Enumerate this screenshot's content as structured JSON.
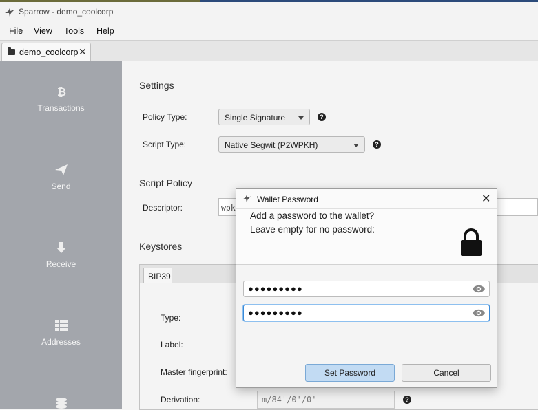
{
  "window": {
    "title": "Sparrow - demo_coolcorp"
  },
  "menu": [
    {
      "label": "File"
    },
    {
      "label": "View"
    },
    {
      "label": "Tools"
    },
    {
      "label": "Help"
    }
  ],
  "tab": {
    "label": "demo_coolcorp",
    "close": "✕"
  },
  "sidebar": {
    "items": [
      {
        "label": "Transactions",
        "icon": "bitcoin-icon"
      },
      {
        "label": "Send",
        "icon": "send-icon"
      },
      {
        "label": "Receive",
        "icon": "arrow-down-icon"
      },
      {
        "label": "Addresses",
        "icon": "list-icon"
      },
      {
        "label": "",
        "icon": "coins-icon"
      }
    ]
  },
  "settings": {
    "title": "Settings",
    "policy_type_label": "Policy Type:",
    "policy_type_value": "Single Signature",
    "script_type_label": "Script Type:",
    "script_type_value": "Native Segwit (P2WPKH)",
    "script_policy_title": "Script Policy",
    "descriptor_label": "Descriptor:",
    "descriptor_value": "wpk",
    "keystores_title": "Keystores",
    "keystore_tab": "BIP39",
    "type_label": "Type:",
    "label_label": "Label:",
    "fingerprint_label": "Master fingerprint:",
    "derivation_label": "Derivation:",
    "derivation_value": "m/84'/0'/0'",
    "help_glyph": "?"
  },
  "dialog": {
    "title": "Wallet Password",
    "close": "✕",
    "message_line1": "Add a password to the wallet?",
    "message_line2": "Leave empty for no password:",
    "password_mask": "●●●●●●●●●",
    "confirm_mask": "●●●●●●●●●",
    "set_password_label": "Set Password",
    "cancel_label": "Cancel"
  },
  "colors": {
    "sidebar": "#a3a6ac",
    "focus": "#3a8ad8",
    "primary_button": "#c2dbf3"
  }
}
